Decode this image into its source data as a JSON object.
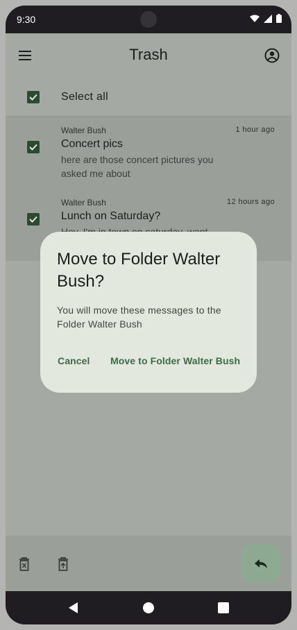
{
  "status_bar": {
    "time": "9:30",
    "icons": [
      "wifi-icon",
      "signal-icon",
      "battery-icon"
    ]
  },
  "app_bar": {
    "title": "Trash",
    "menu_icon": "menu-icon",
    "account_icon": "account-circle-icon"
  },
  "select_all": {
    "label": "Select all",
    "checked": true
  },
  "messages": [
    {
      "sender": "Walter Bush",
      "time": "1 hour ago",
      "subject": "Concert pics",
      "preview": "here are those concert pictures you asked me about",
      "checked": true
    },
    {
      "sender": "Walter Bush",
      "time": "12 hours ago",
      "subject": "Lunch on Saturday?",
      "preview": "Hey, I'm in town on saturday, want",
      "checked": true
    }
  ],
  "dialog": {
    "title": "Move to Folder Walter Bush?",
    "body": "You will move these messages to the Folder Walter Bush",
    "cancel_label": "Cancel",
    "confirm_label": "Move to Folder Walter Bush"
  },
  "bottom_bar": {
    "icons": [
      "delete-forever-icon",
      "restore-from-trash-icon"
    ],
    "fab_icon": "reply-icon"
  },
  "nav_bar": {
    "icons": [
      "back-icon",
      "home-icon",
      "recents-icon"
    ]
  },
  "colors": {
    "accent": "#2b4a31",
    "dialog_bg": "#e3e8df",
    "button_text": "#3c6b44"
  }
}
